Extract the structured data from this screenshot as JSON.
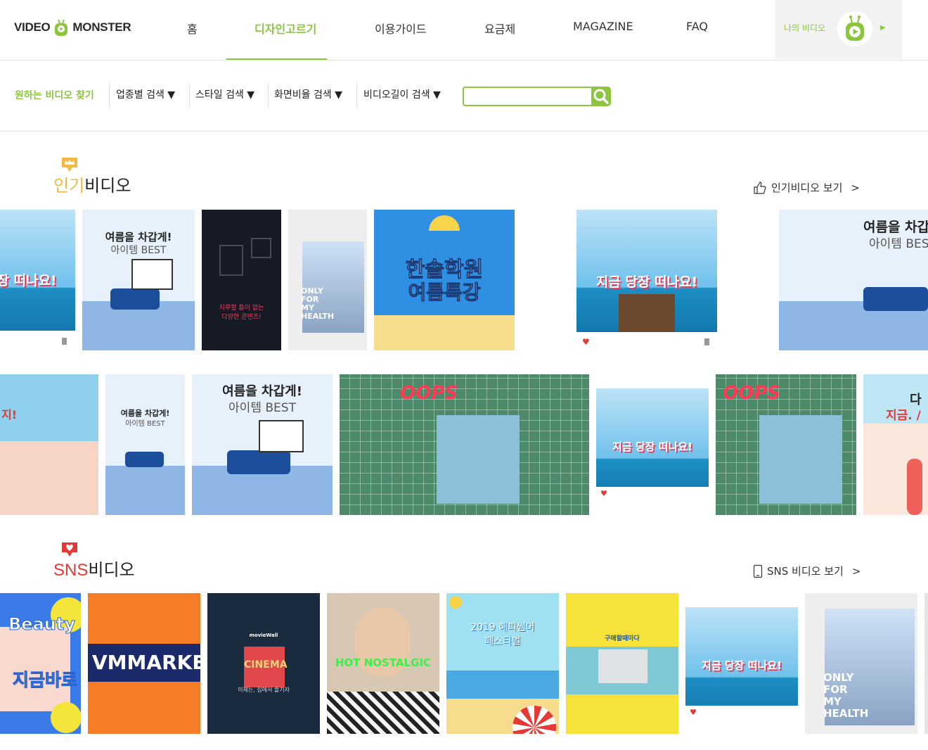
{
  "header": {
    "logo_left": "VIDEO",
    "logo_right": "MONSTER",
    "nav": [
      {
        "label": "홈",
        "active": false
      },
      {
        "label": "디자인고르기",
        "active": true
      },
      {
        "label": "이용가이드",
        "active": false
      },
      {
        "label": "요금제",
        "active": false
      },
      {
        "label": "MAGAZINE",
        "active": false
      },
      {
        "label": "FAQ",
        "active": false
      }
    ],
    "my_video_label": "나의 비디오"
  },
  "filters": {
    "title": "원하는 비디오 찾기",
    "options": [
      "업종별 검색 ▼",
      "스타일 검색 ▼",
      "화면비율 검색 ▼",
      "비디오길이 검색 ▼"
    ],
    "search_value": "",
    "search_icon": "search-icon"
  },
  "popular": {
    "title_highlight": "인기",
    "title_rest": "비디오",
    "view_all": "인기비디오 보기",
    "chevron": ">",
    "thumb_texts": {
      "travel": "지금 당장 떠나요!",
      "interior_title": "여름을 차갑게!",
      "interior_sub": "아이템 BEST",
      "dark_room": "지루할 틈이 없는\n다양한 콘텐츠!",
      "health": "ONLY FOR MY HEALTH",
      "academy_1": "한솔학원",
      "academy_2": "여름특강",
      "oops": "OOPS",
      "beach_cut": "다",
      "beach_cut_2": "지금. /"
    }
  },
  "sns": {
    "title_highlight": "SNS",
    "title_rest": "비디오",
    "view_all": "SNS 비디오 보기",
    "chevron": ">",
    "thumb_texts": {
      "beauty_1": "Beauty",
      "beauty_2": "지금바로",
      "vmmarket": "VMMARKET",
      "cinema_brand": "movieWall",
      "cinema": "CINEMA",
      "cinema_sub": "이제는, 집에서 즐기자",
      "nostalgic": "HOT NOSTALGIC",
      "festival": "2019 해피썸머\n페스티벌",
      "shop": "구매할때마다",
      "travel": "지금 당장 떠나요!",
      "health": "ONLY FOR MY HEALTH"
    }
  },
  "colors": {
    "brand_green": "#8cc63f",
    "popular_yellow": "#f4b942",
    "sns_red": "#e53935"
  }
}
